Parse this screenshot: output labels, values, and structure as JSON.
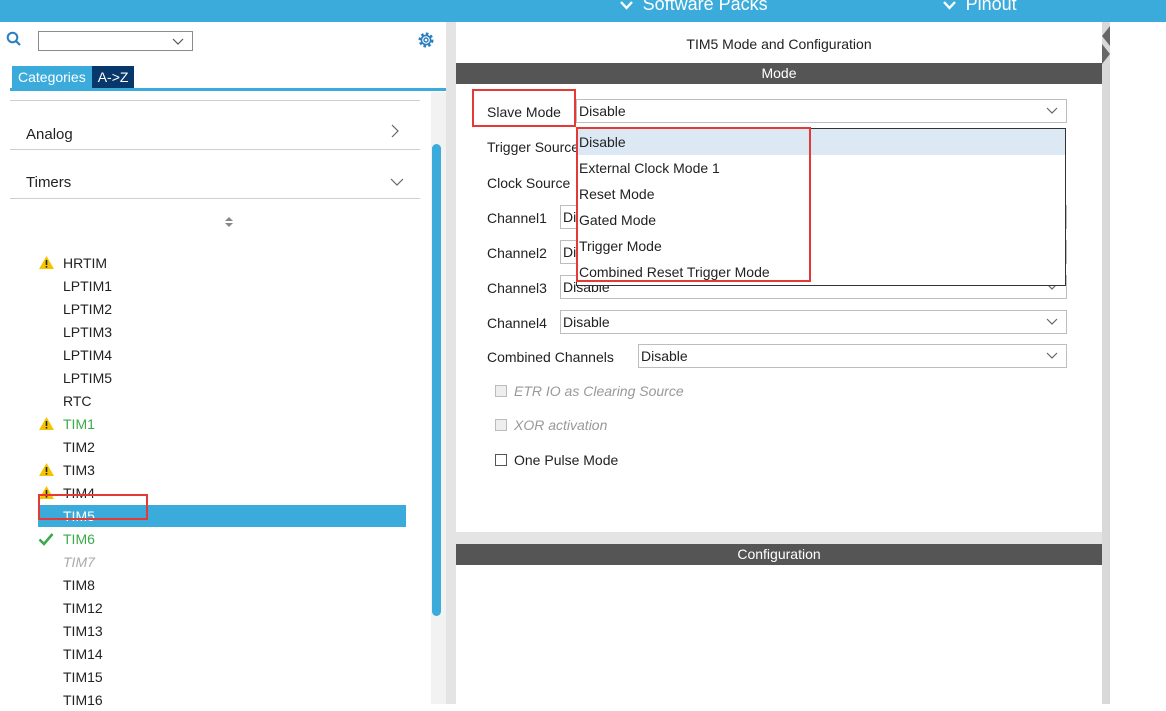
{
  "topbar": {
    "software_packs": "Software Packs",
    "pinout": "Pinout",
    "bg_color": "#3aabdb"
  },
  "left": {
    "search_placeholder": "",
    "tabs": [
      {
        "label": "Categories",
        "active": true
      },
      {
        "label": "A->Z",
        "active": false
      }
    ],
    "categories": [
      {
        "label": "Analog",
        "expanded": false
      },
      {
        "label": "Timers",
        "expanded": true
      }
    ],
    "timer_items": [
      {
        "label": "HRTIM",
        "icon": "warning-icon",
        "style": "normal"
      },
      {
        "label": "LPTIM1",
        "icon": "",
        "style": "normal"
      },
      {
        "label": "LPTIM2",
        "icon": "",
        "style": "normal"
      },
      {
        "label": "LPTIM3",
        "icon": "",
        "style": "normal"
      },
      {
        "label": "LPTIM4",
        "icon": "",
        "style": "normal"
      },
      {
        "label": "LPTIM5",
        "icon": "",
        "style": "normal"
      },
      {
        "label": "RTC",
        "icon": "",
        "style": "normal"
      },
      {
        "label": "TIM1",
        "icon": "warning-icon",
        "style": "green"
      },
      {
        "label": "TIM2",
        "icon": "",
        "style": "normal"
      },
      {
        "label": "TIM3",
        "icon": "warning-icon",
        "style": "normal"
      },
      {
        "label": "TIM4",
        "icon": "warning-icon",
        "style": "normal"
      },
      {
        "label": "TIM5",
        "icon": "",
        "style": "selected"
      },
      {
        "label": "TIM6",
        "icon": "check-icon",
        "style": "green"
      },
      {
        "label": "TIM7",
        "icon": "",
        "style": "disabled"
      },
      {
        "label": "TIM8",
        "icon": "",
        "style": "normal"
      },
      {
        "label": "TIM12",
        "icon": "",
        "style": "normal"
      },
      {
        "label": "TIM13",
        "icon": "",
        "style": "normal"
      },
      {
        "label": "TIM14",
        "icon": "",
        "style": "normal"
      },
      {
        "label": "TIM15",
        "icon": "",
        "style": "normal"
      },
      {
        "label": "TIM16",
        "icon": "",
        "style": "normal"
      }
    ]
  },
  "right": {
    "title": "TIM5 Mode and Configuration",
    "mode_header": "Mode",
    "configuration_header": "Configuration",
    "fields": {
      "slave_mode": {
        "label": "Slave Mode",
        "value": "Disable"
      },
      "trigger_source": {
        "label": "Trigger Source",
        "value": ""
      },
      "clock_source": {
        "label": "Clock Source",
        "value": ""
      },
      "channel1": {
        "label": "Channel1",
        "value": "Disable"
      },
      "channel2": {
        "label": "Channel2",
        "value": "Disable"
      },
      "channel3": {
        "label": "Channel3",
        "value": "Disable"
      },
      "channel4": {
        "label": "Channel4",
        "value": "Disable"
      },
      "combined_channels": {
        "label": "Combined Channels",
        "value": "Disable"
      }
    },
    "dropdown_options": [
      "Disable",
      "External Clock Mode 1",
      "Reset Mode",
      "Gated Mode",
      "Trigger Mode",
      "Combined Reset Trigger Mode"
    ],
    "checkboxes": [
      {
        "label": "ETR IO as Clearing Source",
        "enabled": false,
        "checked": false
      },
      {
        "label": "XOR activation",
        "enabled": false,
        "checked": false
      },
      {
        "label": "One Pulse Mode",
        "enabled": true,
        "checked": false
      }
    ]
  },
  "colors": {
    "accent": "#3aabdb",
    "highlight_box": "#e53935",
    "header_bar": "#555555",
    "ok_green": "#3aab4a",
    "warning_yellow": "#f5c400"
  }
}
